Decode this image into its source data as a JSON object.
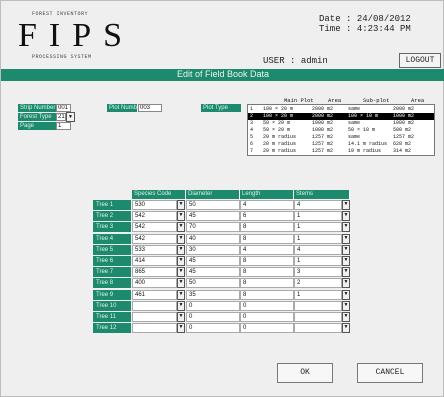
{
  "header": {
    "logo_top": "FOREST INVENTORY",
    "logo_main": "FIPS",
    "logo_bottom": "PROCESSING SYSTEM",
    "date_label": "Date",
    "date_value": "24/08/2012",
    "time_label": "Time",
    "time_value": "4:23:44 PM",
    "user_label": "USER",
    "user_value": "admin",
    "logout_label": "LOGOUT"
  },
  "page_title": "Edit of Field Book Data",
  "form": {
    "strip_number_label": "Strip Number",
    "strip_number_value": "001",
    "forest_type_label": "Forest Type",
    "forest_type_value": "21",
    "page_label": "Page",
    "page_value": "1",
    "plot_number_label": "Plot Number",
    "plot_number_value": "003",
    "plot_type_label": "Plot Type"
  },
  "plot_types": {
    "headers": [
      "Main Plot",
      "Area",
      "Sub-plot",
      "Area"
    ],
    "rows": [
      {
        "n": "1",
        "main": "100 × 20 m",
        "area": "2000 m2",
        "sub": "same",
        "sarea": "2000 m2"
      },
      {
        "n": "2",
        "main": "100 × 20 m",
        "area": "2000 m2",
        "sub": "100 × 10 m",
        "sarea": "1000 m2"
      },
      {
        "n": "3",
        "main": "50 × 20 m",
        "area": "1000 m2",
        "sub": "same",
        "sarea": "1000 m2"
      },
      {
        "n": "4",
        "main": "50 × 20 m",
        "area": "1000 m2",
        "sub": "50 × 10 m",
        "sarea": "500 m2"
      },
      {
        "n": "5",
        "main": "20 m radius",
        "area": "1257 m2",
        "sub": "same",
        "sarea": "1257 m2"
      },
      {
        "n": "6",
        "main": "20 m radius",
        "area": "1257 m2",
        "sub": "14.1 m radius",
        "sarea": "628 m2"
      },
      {
        "n": "7",
        "main": "20 m radius",
        "area": "1257 m2",
        "sub": "10 m radius",
        "sarea": "314 m2"
      }
    ],
    "selected_index": 1
  },
  "tree_table": {
    "columns": [
      "Species Code",
      "Diameter",
      "Length",
      "Stems"
    ],
    "dropdown_glyph": "▼",
    "rows": [
      {
        "label": "Tree 1",
        "species": "530",
        "diameter": "50",
        "length": "4",
        "stems": "4"
      },
      {
        "label": "Tree 2",
        "species": "542",
        "diameter": "45",
        "length": "6",
        "stems": "1"
      },
      {
        "label": "Tree 3",
        "species": "542",
        "diameter": "70",
        "length": "8",
        "stems": "1"
      },
      {
        "label": "Tree 4",
        "species": "542",
        "diameter": "40",
        "length": "8",
        "stems": "1"
      },
      {
        "label": "Tree 5",
        "species": "533",
        "diameter": "30",
        "length": "4",
        "stems": "4"
      },
      {
        "label": "Tree 6",
        "species": "414",
        "diameter": "45",
        "length": "8",
        "stems": "1"
      },
      {
        "label": "Tree 7",
        "species": "865",
        "diameter": "45",
        "length": "8",
        "stems": "3"
      },
      {
        "label": "Tree 8",
        "species": "400",
        "diameter": "50",
        "length": "8",
        "stems": "2"
      },
      {
        "label": "Tree 9",
        "species": "461",
        "diameter": "35",
        "length": "8",
        "stems": "1"
      },
      {
        "label": "Tree 10",
        "species": "",
        "diameter": "0",
        "length": "0",
        "stems": ""
      },
      {
        "label": "Tree 11",
        "species": "",
        "diameter": "0",
        "length": "0",
        "stems": ""
      },
      {
        "label": "Tree 12",
        "species": "",
        "diameter": "0",
        "length": "0",
        "stems": ""
      }
    ]
  },
  "buttons": {
    "ok_label": "OK",
    "cancel_label": "CANCEL"
  },
  "colors": {
    "accent": "#1e8a6d",
    "selection": "#000000"
  }
}
